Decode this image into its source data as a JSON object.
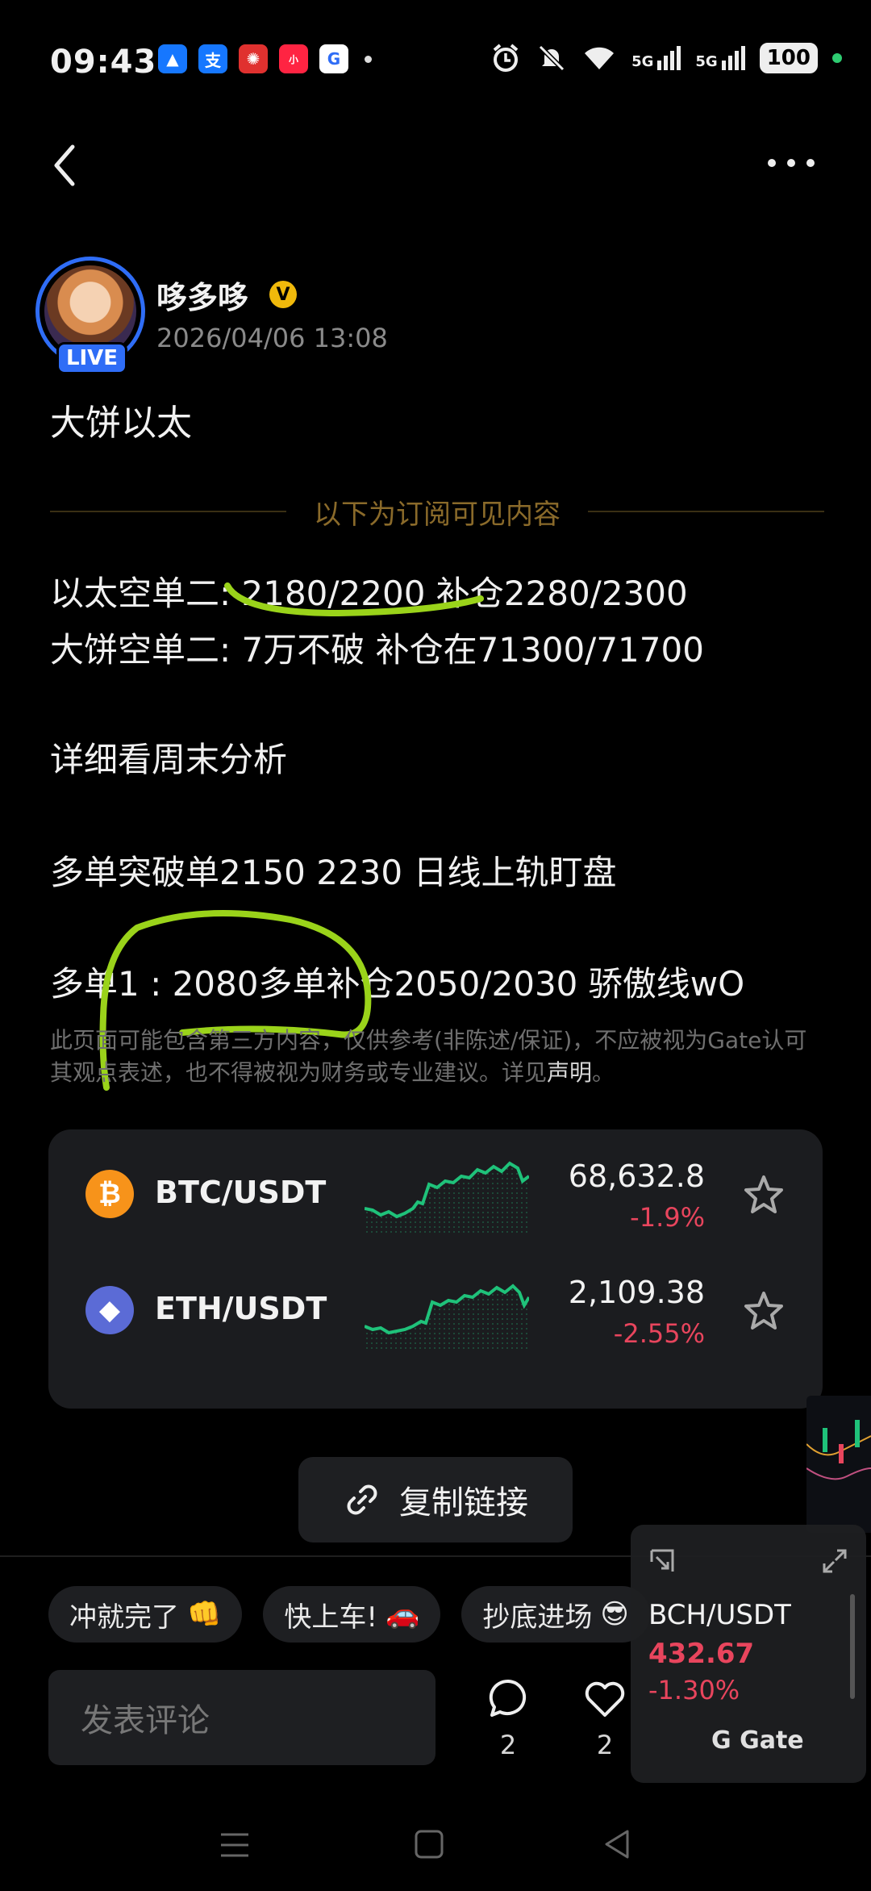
{
  "status_bar": {
    "time": "09:43",
    "app_icons": [
      "alipay-cloud-icon",
      "alipay-icon",
      "app-red-icon",
      "xiaohongshu-icon",
      "gate-app-icon"
    ],
    "network_1": "5G",
    "network_2": "5G",
    "battery": "100"
  },
  "author": {
    "name": "哆多哆",
    "verified_mark": "V",
    "live_badge": "LIVE",
    "date": "2026/04/06 13:08"
  },
  "post": {
    "title": "大饼以太",
    "divider_label": "以下为订阅可见内容",
    "line1": "以太空单二: 2180/2200  补仓2280/2300",
    "line2": "大饼空单二: 7万不破  补仓在71300/71700",
    "line3": "详细看周末分析",
    "line4": "多单突破单2150  2230 日线上轨盯盘",
    "line5": "多单1 : 2080多单补仓2050/2030 骄傲线wO",
    "disclaimer_text": "此页面可能包含第三方内容，仅供参考(非陈述/保证)，不应被视为Gate认可其观点表述，也不得被视为财务或专业建议。详见",
    "disclaimer_link": "声明",
    "disclaimer_end": "。"
  },
  "markets": [
    {
      "icon": "bitcoin-icon",
      "symbol": "₿",
      "pair": "BTC/USDT",
      "price": "68,632.8",
      "change": "-1.9%",
      "color": "#f7931a"
    },
    {
      "icon": "ethereum-icon",
      "symbol": "◆",
      "pair": "ETH/USDT",
      "price": "2,109.38",
      "change": "-2.55%",
      "color": "#5b6bd6"
    }
  ],
  "copy_link": {
    "label": "复制链接"
  },
  "quick_replies": [
    {
      "text": "冲就完了",
      "emoji": "👊"
    },
    {
      "text": "快上车!",
      "emoji": "🚗"
    },
    {
      "text": "抄底进场",
      "emoji": "😎"
    }
  ],
  "comment": {
    "placeholder": "发表评论"
  },
  "actions": {
    "comments": "2",
    "likes": "2"
  },
  "float_widget": {
    "pair": "BCH/USDT",
    "price": "432.67",
    "change": "-1.30%",
    "brand": "Gate"
  },
  "colors": {
    "accent": "#2f6df6",
    "down": "#e8455d",
    "up": "#1fc27a",
    "gold": "#f0b90b"
  }
}
